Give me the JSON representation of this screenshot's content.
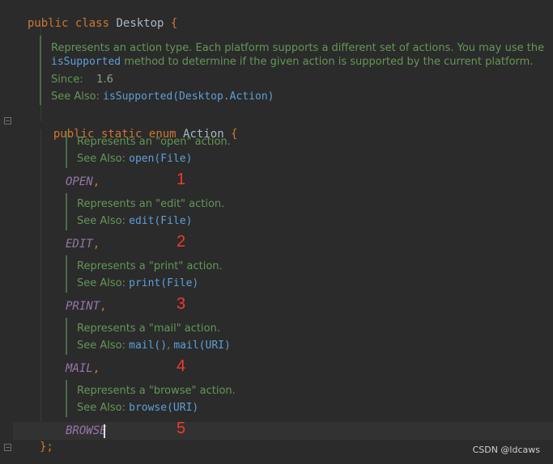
{
  "code": {
    "class_decl": {
      "kw1": "public",
      "kw2": "class",
      "name": "Desktop",
      "brace": "{"
    },
    "class_doc": {
      "line1": "Represents an action type. Each platform supports a different set of actions. You may use the",
      "line2_link": "isSupported",
      "line2_rest": " method to determine if the given action is supported by the current platform.",
      "since_label": "Since:",
      "since_value": "1.6",
      "seealso_label": "See Also: ",
      "seealso_link": "isSupported(Desktop.Action)"
    },
    "enum_decl": {
      "kw1": "public",
      "kw2": "static",
      "kw3": "enum",
      "name": "Action",
      "brace": "{"
    },
    "constants": [
      {
        "doc": "Represents an \"open\" action.",
        "seealso_label": "See Also: ",
        "links": [
          "open(File)"
        ],
        "name": "OPEN",
        "sep": ",",
        "marker": "1"
      },
      {
        "doc": "Represents an \"edit\" action.",
        "seealso_label": "See Also: ",
        "links": [
          "edit(File)"
        ],
        "name": "EDIT",
        "sep": ",",
        "marker": "2"
      },
      {
        "doc": "Represents a \"print\" action.",
        "seealso_label": "See Also: ",
        "links": [
          "print(File)"
        ],
        "name": "PRINT",
        "sep": ",",
        "marker": "3"
      },
      {
        "doc": "Represents a \"mail\" action.",
        "seealso_label": "See Also: ",
        "links": [
          "mail()",
          "mail(URI)"
        ],
        "name": "MAIL",
        "sep": ",",
        "marker": "4"
      },
      {
        "doc": "Represents a \"browse\" action.",
        "seealso_label": "See Also: ",
        "links": [
          "browse(URI)"
        ],
        "name": "BROWSE",
        "sep": "",
        "marker": "5"
      }
    ],
    "enum_close": "};",
    "link_comma": ", "
  },
  "watermark": "CSDN @ldcaws",
  "colors": {
    "background": "#2b2b2b",
    "keyword": "#cc7832",
    "doc": "#629755",
    "link": "#5e9fd8",
    "enum_const": "#9876aa",
    "marker": "#f03a2e"
  }
}
